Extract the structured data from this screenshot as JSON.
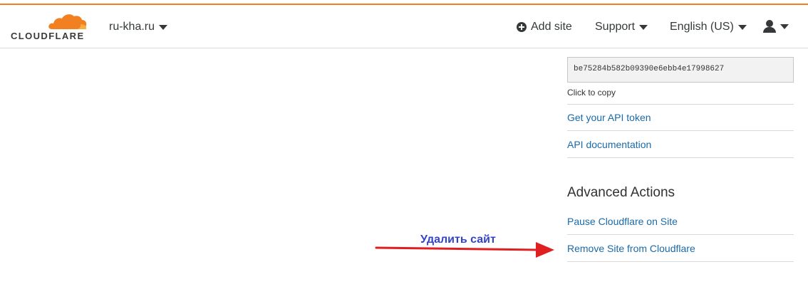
{
  "header": {
    "logo_text": "CLOUDFLARE",
    "site_selector": "ru-kha.ru",
    "add_site": "Add site",
    "support": "Support",
    "language": "English (US)"
  },
  "sidebar": {
    "api_key": "be75284b582b09390e6ebb4e17998627",
    "copy_hint": "Click to copy",
    "links": [
      "Get your API token",
      "API documentation"
    ],
    "advanced_title": "Advanced Actions",
    "advanced_links": [
      "Pause Cloudflare on Site",
      "Remove Site from Cloudflare"
    ]
  },
  "annotation": {
    "text": "Удалить сайт",
    "color": "#3344c9",
    "arrow_color": "#e02020"
  },
  "colors": {
    "brand_orange": "#f38020",
    "link_blue": "#1a6aa8"
  }
}
